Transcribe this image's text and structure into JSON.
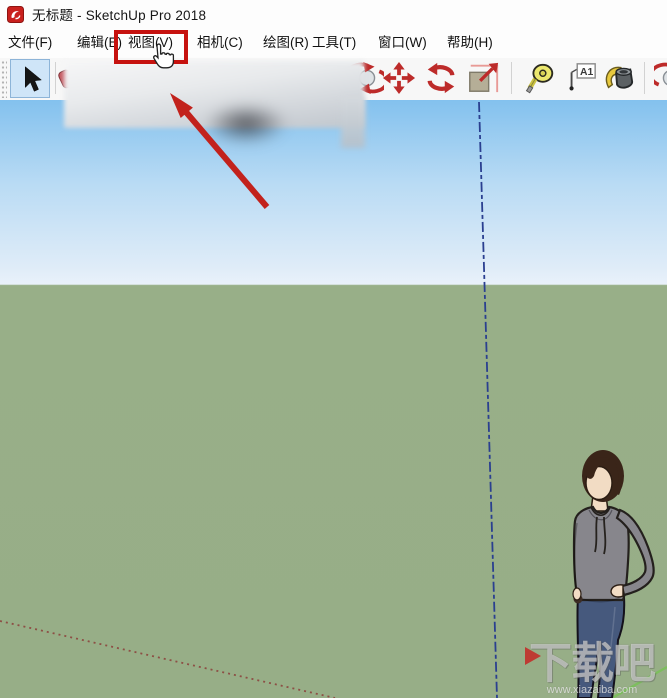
{
  "window": {
    "title": "无标题 - SketchUp Pro 2018"
  },
  "menu_bar": {
    "items": [
      {
        "label": "文件(F)"
      },
      {
        "label": "编辑(E)"
      },
      {
        "label": "视图(V)"
      },
      {
        "label": "相机(C)"
      },
      {
        "label": "绘图(R)"
      },
      {
        "label": "工具(T)"
      },
      {
        "label": "窗口(W)"
      },
      {
        "label": "帮助(H)"
      }
    ],
    "highlighted_item": "视图(V)"
  },
  "toolbar": {
    "selected_tool": "select",
    "tools": [
      "select",
      "eraser",
      "orbit",
      "move",
      "rotate",
      "scale",
      "tape-measure",
      "text",
      "paint-bucket",
      "orbit"
    ],
    "text_tool_glyph": "A1"
  },
  "annotations": {
    "highlight_box_target": "视图(V)",
    "highlight_color": "#c6120f",
    "arrow_color": "#c2221c"
  },
  "viewport": {
    "sky_top_color": "#83c1ee",
    "sky_horizon_color": "#e9f1fa",
    "ground_color": "#98af88",
    "blue_axis_color": "#2a3f90",
    "red_axis_color": "#8d4f45"
  },
  "watermark": {
    "brand": "下载吧",
    "url": "www.xiazaiba.com"
  }
}
